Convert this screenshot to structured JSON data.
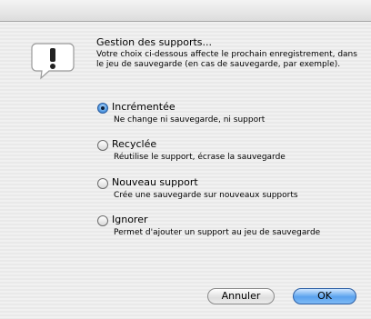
{
  "dialog": {
    "heading": "Gestion des supports...",
    "message": "Votre choix ci-dessous affecte le prochain enregistrement, dans le jeu de sauvegarde (en cas de sauvegarde, par exemple).",
    "icon": "caution-alert-icon"
  },
  "options": [
    {
      "label": "Incrémentée",
      "description": "Ne change ni sauvegarde, ni support",
      "selected": true
    },
    {
      "label": "Recyclée",
      "description": "Réutilise le support, écrase la sauvegarde",
      "selected": false
    },
    {
      "label": "Nouveau support",
      "description": "Crée une sauvegarde sur nouveaux supports",
      "selected": false
    },
    {
      "label": "Ignorer",
      "description": "Permet d'ajouter un support au jeu de sauvegarde",
      "selected": false
    }
  ],
  "buttons": {
    "cancel": "Annuler",
    "ok": "OK"
  },
  "colors": {
    "default_button": "#5aa2ee",
    "selected_radio": "#3b82d6"
  }
}
